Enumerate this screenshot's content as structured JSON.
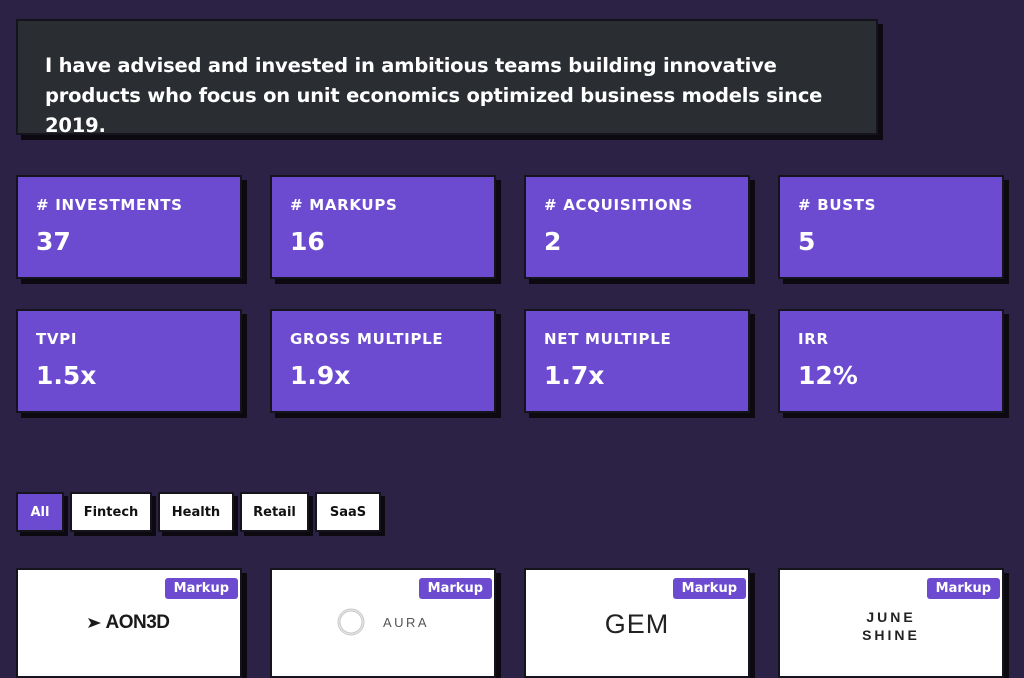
{
  "intro": {
    "text": "I have advised and invested in ambitious teams building innovative products who focus on unit economics optimized business models since 2019."
  },
  "stats": [
    {
      "label": "# INVESTMENTS",
      "value": "37"
    },
    {
      "label": "# MARKUPS",
      "value": "16"
    },
    {
      "label": "# ACQUISITIONS",
      "value": "2"
    },
    {
      "label": "# BUSTS",
      "value": "5"
    },
    {
      "label": "TVPI",
      "value": "1.5x"
    },
    {
      "label": "GROSS MULTIPLE",
      "value": "1.9x"
    },
    {
      "label": "NET MULTIPLE",
      "value": "1.7x"
    },
    {
      "label": "IRR",
      "value": "12%"
    }
  ],
  "filters": [
    {
      "label": "All",
      "active": true
    },
    {
      "label": "Fintech"
    },
    {
      "label": "Health"
    },
    {
      "label": "Retail"
    },
    {
      "label": "SaaS"
    }
  ],
  "companies": [
    {
      "logo_text": "AON3D",
      "badge": "Markup"
    },
    {
      "logo_text": "AURA",
      "badge": "Markup"
    },
    {
      "logo_text": "GEM",
      "badge": "Markup"
    },
    {
      "logo_text": "JUNE\nSHINE",
      "badge": "Markup"
    }
  ],
  "colors": {
    "background": "#2c2245",
    "accent": "#6c4bd1",
    "intro_bg": "#2a2e33",
    "card_bg": "#ffffff"
  }
}
